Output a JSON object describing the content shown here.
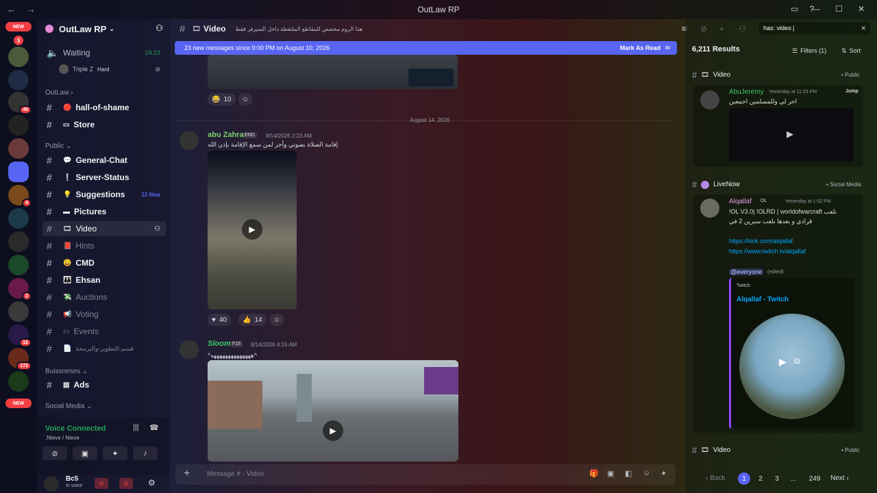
{
  "window": {
    "title": "OutLaw RP"
  },
  "servers": {
    "new_top": "NEW",
    "new_top_count": "3",
    "new_bottom": "NEW",
    "badges": [
      "40",
      "4",
      "2",
      "12",
      "172"
    ]
  },
  "guild": {
    "name": "OutLaw RP"
  },
  "sidebar": {
    "waiting": {
      "name": "Waiting",
      "time": "19:23"
    },
    "voice_user": {
      "name": "Triple Z",
      "tag": "Hard"
    },
    "categories": {
      "outlaw": "OutLaw",
      "public": "Public",
      "business": "Buissneses",
      "social": "Social Media"
    },
    "channels": [
      {
        "label": "hall-of-shame"
      },
      {
        "label": "Store"
      },
      {
        "label": "General-Chat"
      },
      {
        "label": "Server-Status"
      },
      {
        "label": "Suggestions",
        "badge": "12 New"
      },
      {
        "label": "Pictures"
      },
      {
        "label": "Video"
      },
      {
        "label": "Hints"
      },
      {
        "label": "CMD"
      },
      {
        "label": "Ehsan"
      },
      {
        "label": "Auctions"
      },
      {
        "label": "Voting"
      },
      {
        "label": "Events"
      },
      {
        "label": "قسم-التطوير-والبرمجة"
      },
      {
        "label": "Ads"
      }
    ]
  },
  "voice": {
    "status": "Voice Connected",
    "channel": ".Nieve / Nieve"
  },
  "user": {
    "name": "Bc5",
    "status": "In voice"
  },
  "chat": {
    "channel": "Video",
    "topic": "هذا الروم مخصص للمقاطع الملتقطة داخل السيرفر فقط",
    "newbar": "23 new messages since 9:00 PM on August 10, 2026",
    "mark_read": "Mark As Read",
    "date_divider": "August 14, 2026",
    "reactions1": [
      {
        "emoji": "😂",
        "count": "10"
      }
    ],
    "msg2": {
      "author": "abu Zahra",
      "tag": "END",
      "time": "8/14/2026 2:23 AM",
      "text": "إقامة الصلاة بصوتي وأجر لمن سمع الإقامة بإذن الله"
    },
    "reactions2": [
      {
        "emoji": "♥",
        "count": "40"
      },
      {
        "emoji": "👍",
        "count": "14"
      }
    ],
    "msg3": {
      "author": "Sloom",
      "tag": "F15",
      "time": "8/14/2026 4:15 AM",
      "text": "^ههههههههههههههه^"
    },
    "composer_placeholder": "Message # - Video"
  },
  "search": {
    "query": "has: video",
    "results_count": "6,211 Results",
    "filters_label": "Filters (1)",
    "sort_label": "Sort",
    "result1": {
      "channel": "Video",
      "category": "Public",
      "author": "AbuJeremy",
      "time": "Yesterday at 11:23 PM",
      "jump": "Jump",
      "text": "اجر لي وللمسلمين اجمعين"
    },
    "result2": {
      "channel": "LiveNow",
      "category": "Social Media",
      "author": "Alqallaf",
      "tag": "OL",
      "time": "Yesterday at 1:52 PM",
      "line1": "!OL V3.0| !OLRD | worldofwarcraft نلعب",
      "line2": "قرادي و بعدها نلعب سيرين 2 في",
      "link1": "https://kick.com/alqallaf",
      "link2": "https://www.twitch.tv/alqallaf",
      "mention": "@everyone",
      "edited": "(edited)",
      "embed_provider": "Twitch",
      "embed_title": "Alqallaf - Twitch"
    },
    "result3": {
      "channel": "Video",
      "category": "Public"
    },
    "pager": {
      "back": "Back",
      "pages": [
        "1",
        "2",
        "3",
        "...",
        "249"
      ],
      "next": "Next"
    }
  },
  "colors": {
    "accent": "#5865f2",
    "online": "#23a55a",
    "link": "#00a8fc",
    "danger": "#f23f43"
  }
}
